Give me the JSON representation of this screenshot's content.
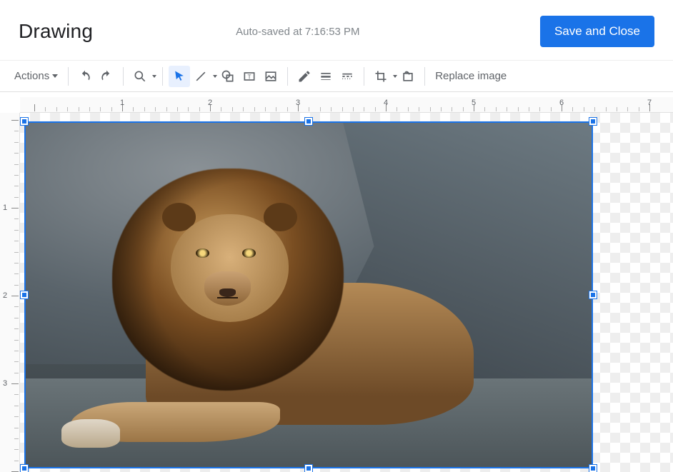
{
  "header": {
    "title": "Drawing",
    "save_status": "Auto-saved at 7:16:53 PM",
    "save_btn": "Save and Close"
  },
  "toolbar": {
    "actions_label": "Actions",
    "replace_label": "Replace image"
  },
  "ruler": {
    "h": [
      "1",
      "2",
      "3",
      "4",
      "5",
      "6",
      "7"
    ],
    "v": [
      "1",
      "2",
      "3"
    ]
  },
  "canvas": {
    "selected_image_alt": "lion-photo"
  }
}
